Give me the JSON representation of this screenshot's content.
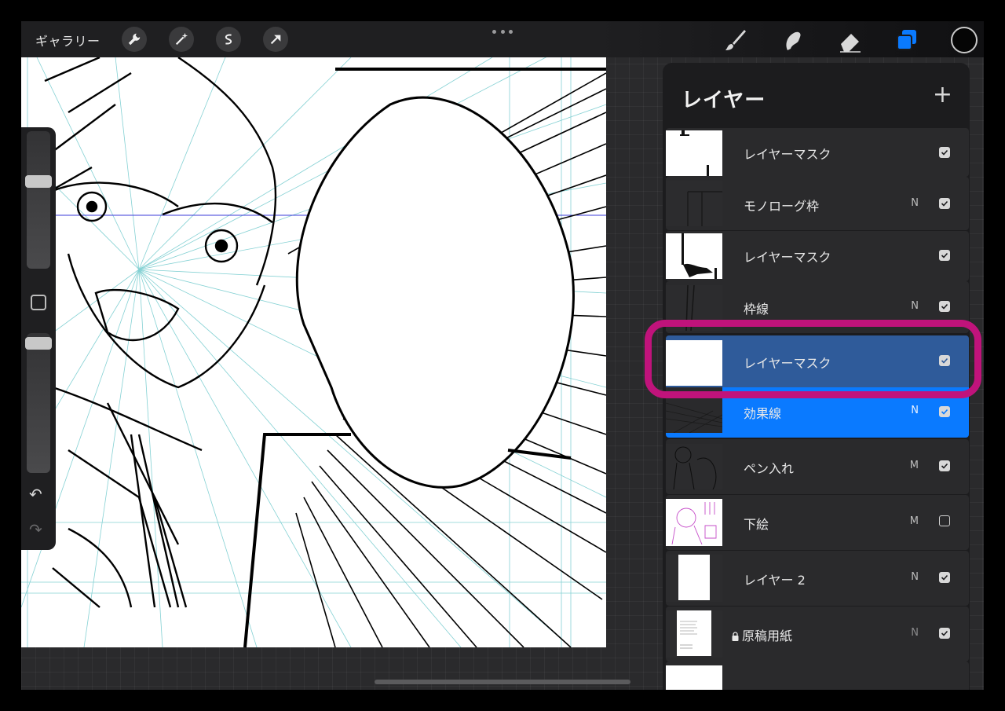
{
  "topbar": {
    "gallery_label": "ギャラリー",
    "left_tools": [
      "wrench-icon",
      "magic-wand-icon",
      "selection-icon",
      "transform-arrow-icon"
    ],
    "right_tools": [
      "brush-icon",
      "smudge-icon",
      "eraser-icon",
      "layers-icon"
    ],
    "active_color": "#050505",
    "accent": "#0a7aff"
  },
  "layers_panel": {
    "title": "レイヤー",
    "add_symbol": "+",
    "layers": [
      {
        "name": "レイヤーマスク",
        "mode": "",
        "checked": true,
        "thumb": "mask1",
        "state": "normal"
      },
      {
        "name": "モノローグ枠",
        "mode": "N",
        "checked": true,
        "thumb": "dark-frame",
        "state": "normal"
      },
      {
        "name": "レイヤーマスク",
        "mode": "",
        "checked": true,
        "thumb": "mask2",
        "state": "normal"
      },
      {
        "name": "枠線",
        "mode": "N",
        "checked": true,
        "thumb": "dark-lines",
        "state": "normal"
      },
      {
        "name": "レイヤーマスク",
        "mode": "",
        "checked": true,
        "thumb": "white",
        "state": "mask-selected"
      },
      {
        "name": "効果線",
        "mode": "N",
        "checked": true,
        "thumb": "dark-rays",
        "state": "selected"
      },
      {
        "name": "ペン入れ",
        "mode": "M",
        "checked": true,
        "thumb": "sketch",
        "state": "normal"
      },
      {
        "name": "下絵",
        "mode": "M",
        "checked": false,
        "thumb": "pink-sketch",
        "state": "normal"
      },
      {
        "name": "レイヤー 2",
        "mode": "N",
        "checked": true,
        "thumb": "white-page",
        "state": "normal"
      },
      {
        "name": "原稿用紙",
        "mode": "N",
        "checked": true,
        "thumb": "paper",
        "state": "normal",
        "locked": true
      }
    ],
    "highlight_color": "#c0137b"
  }
}
